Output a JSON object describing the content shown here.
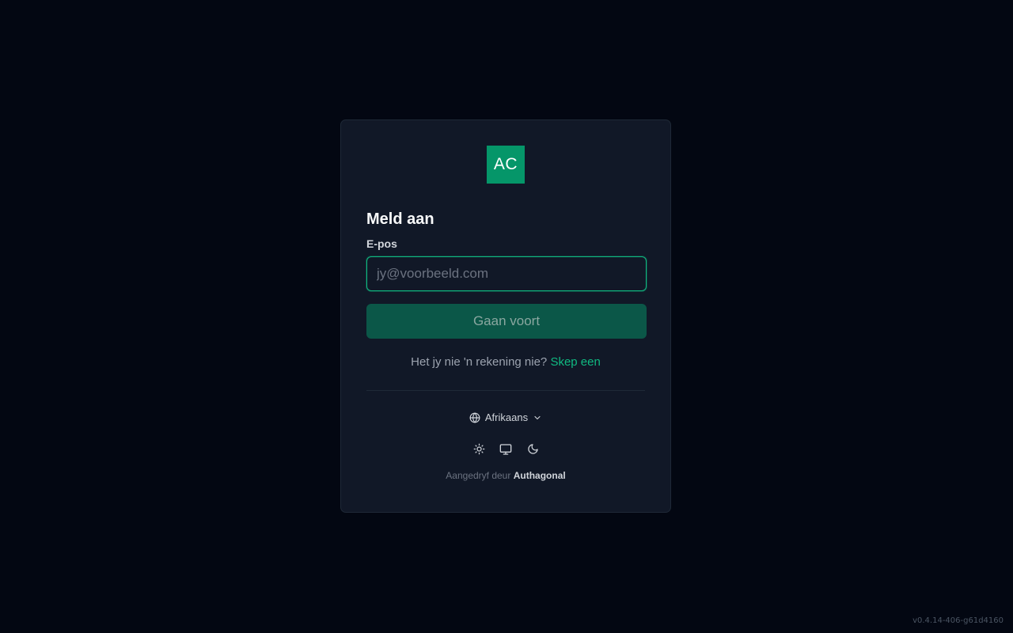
{
  "logo": {
    "text": "AC",
    "color": "#059669"
  },
  "form": {
    "title": "Meld aan",
    "email_label": "E-pos",
    "email_placeholder": "jy@voorbeeld.com",
    "email_value": "",
    "submit_label": "Gaan voort"
  },
  "signup": {
    "prompt": "Het jy nie 'n rekening nie?",
    "link_label": "Skep een"
  },
  "language": {
    "icon": "globe-icon",
    "selected": "Afrikaans",
    "chevron_icon": "chevron-down-icon"
  },
  "theme": {
    "options": [
      "sun-icon",
      "monitor-icon",
      "moon-icon"
    ]
  },
  "footer": {
    "powered_prefix": "Aangedryf deur",
    "powered_brand": "Authagonal"
  },
  "version": "v0.4.14-406-g61d4160",
  "colors": {
    "background": "#030712",
    "card": "#111827",
    "accent": "#10b981",
    "button": "#0b5748"
  }
}
